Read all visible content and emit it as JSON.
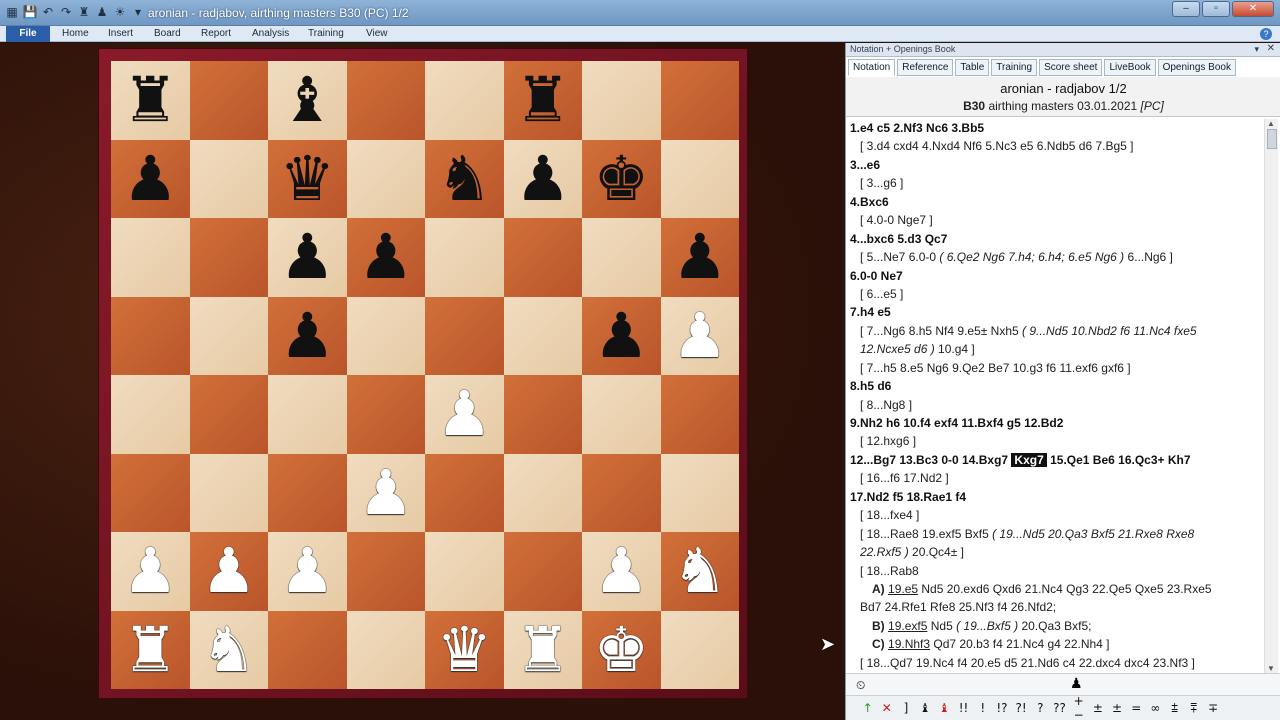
{
  "window": {
    "title": "aronian - radjabov, airthing masters  B30  (PC)  1/2"
  },
  "quick_access": [
    "▦",
    "💾",
    "↶",
    "↷",
    "♜",
    "♟",
    "☀",
    "▾"
  ],
  "window_buttons": {
    "min": "–",
    "max": "▫",
    "close": "✕"
  },
  "ribbon": {
    "file": "File",
    "tabs": [
      "Home",
      "Insert",
      "Board",
      "Report",
      "Analysis",
      "Training",
      "View"
    ],
    "help": "?"
  },
  "board": {
    "ranks": [
      [
        "r",
        "",
        "b",
        "",
        "",
        "r",
        "",
        ""
      ],
      [
        "p",
        "",
        "q",
        "",
        "n",
        "p",
        "k",
        ""
      ],
      [
        "",
        "",
        "p",
        "p",
        "",
        "",
        "",
        "p"
      ],
      [
        "",
        "",
        "p",
        "",
        "",
        "",
        "p",
        "P"
      ],
      [
        "",
        "",
        "",
        "",
        "P",
        "",
        "",
        ""
      ],
      [
        "",
        "",
        "",
        "P",
        "",
        "",
        "",
        ""
      ],
      [
        "P",
        "P",
        "P",
        "",
        "",
        "",
        "P",
        "N"
      ],
      [
        "R",
        "N",
        "",
        "",
        "Q",
        "R",
        "K",
        ""
      ]
    ]
  },
  "panel": {
    "title": "Notation + Openings Book",
    "pin": "▾",
    "close": "✕",
    "tabs": [
      "Notation",
      "Reference",
      "Table",
      "Training",
      "Score sheet",
      "LiveBook",
      "Openings Book"
    ],
    "players": "aronian - radjabov  1/2",
    "eco": "B30",
    "event": " airthing masters 03.01.2021 ",
    "source": "[PC]"
  },
  "notation": {
    "l1": "1.e4  c5  2.Nf3  Nc6  3.Bb5",
    "l2": "[ 3.d4  cxd4  4.Nxd4  Nf6  5.Nc3  e5  6.Ndb5  d6  7.Bg5 ]",
    "l3": "3...e6",
    "l4": "[ 3...g6 ]",
    "l5": "4.Bxc6",
    "l6": "[ 4.0-0  Nge7 ]",
    "l7": "4...bxc6  5.d3  Qc7",
    "l8a": "[ 5...Ne7  6.0-0 ",
    "l8b": " ( 6.Qe2  Ng6  7.h4; 6.h4; 6.e5  Ng6 ) ",
    "l8c": "6...Ng6 ]",
    "l9": "6.0-0  Ne7",
    "l10": "[ 6...e5 ]",
    "l11": "7.h4  e5",
    "l12a": "[ 7...Ng6  8.h5  Nf4  9.e5±  Nxh5 ",
    "l12b": " ( 9...Nd5  10.Nbd2  f6  11.Nc4  fxe5",
    "l13a": "12.Ncxe5  d6 ) ",
    "l13b": "10.g4 ]",
    "l14": "[ 7...h5  8.e5  Ng6  9.Qe2  Be7  10.g3  f6  11.exf6  gxf6 ]",
    "l15": "8.h5  d6",
    "l16": "[ 8...Ng8 ]",
    "l17": "9.Nh2  h6  10.f4  exf4  11.Bxf4  g5  12.Bd2",
    "l18": "[ 12.hxg6 ]",
    "l19a": "12...Bg7  13.Bc3  0-0  14.Bxg7 ",
    "l19cur": "Kxg7",
    "l19b": " 15.Qe1  Be6  16.Qc3+  Kh7",
    "l20": "[ 16...f6  17.Nd2 ]",
    "l21": "17.Nd2  f5  18.Rae1  f4",
    "l22": "[ 18...fxe4 ]",
    "l23a": "[ 18...Rae8  19.exf5  Bxf5 ",
    "l23b": " ( 19...Nd5  20.Qa3  Bxf5  21.Rxe8  Rxe8",
    "l24a": "22.Rxf5 ) ",
    "l24b": "20.Qc4± ]",
    "l25": "[ 18...Rab8",
    "l26a": "A)",
    "l26b": "19.e5",
    "l26c": "  Nd5  20.exd6  Qxd6  21.Nc4  Qg3  22.Qe5  Qxe5  23.Rxe5",
    "l27": "Bd7  24.Rfe1  Rfe8  25.Nf3  f4  26.Nfd2;",
    "l28a": "B)",
    "l28b": "19.exf5",
    "l28c": "  Nd5 ",
    "l28d": " ( 19...Bxf5 ) ",
    "l28e": "20.Qa3  Bxf5;",
    "l29a": "C)",
    "l29b": "19.Nhf3",
    "l29c": "  Qd7  20.b3  f4  21.Nc4  g4  22.Nh4 ]",
    "l30": "[ 18...Qd7  19.Nc4  f4  20.e5  d5  21.Nd6  c4  22.dxc4  dxc4  23.Nf3 ]"
  },
  "footer": {
    "left_icon": "⏲",
    "mid_icon": "♟",
    "symbols": [
      "↑",
      "✕",
      "]",
      "♝",
      "♝",
      "!!",
      "!",
      "!?",
      "?!",
      "?",
      "??",
      "+−",
      "±",
      "±",
      "=",
      "∞",
      "⩲",
      "⩱",
      "∓"
    ]
  },
  "colors": {
    "accent": "#2a5ea8",
    "frame": "#8a1a2a",
    "light_square": "#f0dcc0",
    "dark_square": "#c8622f"
  }
}
